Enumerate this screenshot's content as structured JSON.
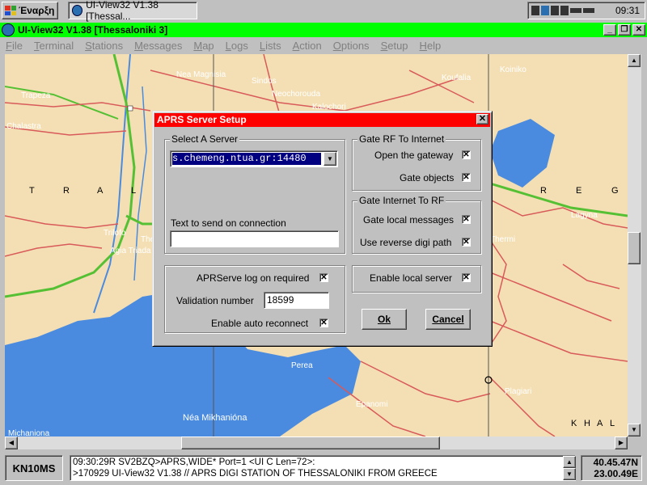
{
  "taskbar": {
    "start_label": "Έναρξη",
    "task_label": "UI-View32 V1.38 [Thessal...",
    "clock": "09:31"
  },
  "window": {
    "title": "UI-View32 V1.38 [Thessaloniki 3]",
    "minimize_glyph": "_",
    "maximize_glyph": "❐",
    "close_glyph": "✕"
  },
  "menu": [
    "File",
    "Terminal",
    "Stations",
    "Messages",
    "Map",
    "Logs",
    "Lists",
    "Action",
    "Options",
    "Setup",
    "Help"
  ],
  "map": {
    "labels": {
      "nea_magnisia": "Nea Magnisia",
      "sindos": "Sindos",
      "neochorouda": "Neochorouda",
      "kalochori": "Kalochori",
      "chalastra": "Chalastra",
      "koufalia": "Koufalia",
      "trapeza": "Trapeza",
      "thessaloniki": "Thessaloniki",
      "nea_mikhaniona": "Néa Mikhanióna",
      "perea": "Perea",
      "epanomi": "Epanomi",
      "plagiari": "Plagiari",
      "nea_michaniona_small": "Michaniona",
      "agia_triada": "Agia Triada",
      "trilofo": "Trilofo",
      "koiniko": "Koiniko",
      "a1": "T",
      "a2": "R",
      "a3": "A",
      "a4": "L",
      "b1": "R",
      "b2": "E",
      "b3": "G",
      "c1": "K",
      "c2": "H",
      "c3": "A",
      "c4": "L",
      "lagyna": "Lagyna",
      "oraiokastro": "Oraiokastro",
      "thermi": "Thermi"
    },
    "colors": {
      "land": "#f4dfb4",
      "water": "#4a8be0",
      "highway": "#56c034",
      "road": "#d85a5a"
    }
  },
  "dialog": {
    "title": "APRS Server Setup",
    "close_glyph": "✕",
    "select_server": {
      "group_label": "Select A Server",
      "value": "s.chemeng.ntua.gr:14480",
      "text_on_connect_label": "Text to send on connection",
      "text_on_connect_value": ""
    },
    "logon": {
      "log_on_label": "APRServe log on required",
      "log_on_checked": "✕",
      "validation_label": "Validation number",
      "validation_value": "18599",
      "auto_reconnect_label": "Enable auto reconnect",
      "auto_reconnect_checked": "✕"
    },
    "gate_rf": {
      "group_label": "Gate RF To Internet",
      "open_gateway_label": "Open the gateway",
      "open_gateway_checked": "✕",
      "gate_objects_label": "Gate objects",
      "gate_objects_checked": "✕"
    },
    "gate_inet": {
      "group_label": "Gate Internet To RF",
      "gate_local_label": "Gate local messages",
      "gate_local_checked": "✕",
      "reverse_digi_label": "Use reverse digi path",
      "reverse_digi_checked": "✕"
    },
    "local_server": {
      "label": "Enable local server",
      "checked": "✕"
    },
    "ok_label": "Ok",
    "cancel_label": "Cancel"
  },
  "status": {
    "locator": "KN10MS",
    "log_line1": "09:30:29R SV2BZQ>APRS,WIDE* Port=1 <UI C Len=72>:",
    "log_line2": ">170929 UI-View32 V1.38 // APRS DIGI STATION OF THESSALONIKI FROM GREECE",
    "lat": "40.45.47N",
    "lon": "23.00.49E"
  }
}
